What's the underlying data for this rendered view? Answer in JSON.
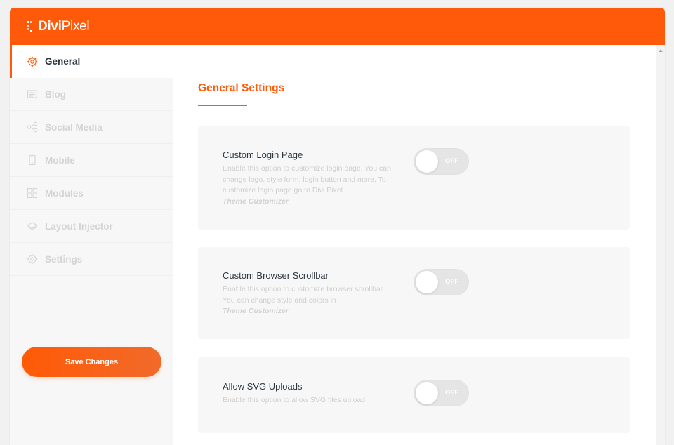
{
  "app": {
    "logo_divi": "Divi",
    "logo_pixel": "Pixel",
    "brand_color": "#ff5a0a"
  },
  "sidebar": {
    "items": [
      {
        "label": "General",
        "icon": "gear-icon",
        "active": true
      },
      {
        "label": "Blog",
        "icon": "blog-icon",
        "active": false
      },
      {
        "label": "Social Media",
        "icon": "share-icon",
        "active": false
      },
      {
        "label": "Mobile",
        "icon": "mobile-icon",
        "active": false
      },
      {
        "label": "Modules",
        "icon": "modules-icon",
        "active": false
      },
      {
        "label": "Layout Injector",
        "icon": "layers-icon",
        "active": false
      },
      {
        "label": "Settings",
        "icon": "gear-icon",
        "active": false
      }
    ],
    "save_label": "Save Changes"
  },
  "main": {
    "title": "General Settings",
    "settings": [
      {
        "title": "Custom Login Page",
        "description": "Enable this option to customize login page. You can change logo, style form, login button and more. To customize login page go to Divi Pixel",
        "link": "Theme Customizer",
        "toggle": "OFF"
      },
      {
        "title": "Custom Browser Scrollbar",
        "description": "Enable this option to customize browser scrollbar. You can change style and colors in",
        "link": "Theme Customizer",
        "toggle": "OFF"
      },
      {
        "title": "Allow SVG Uploads",
        "description": "Enable this option to allow SVG files upload",
        "link": "",
        "toggle": "OFF"
      }
    ]
  }
}
